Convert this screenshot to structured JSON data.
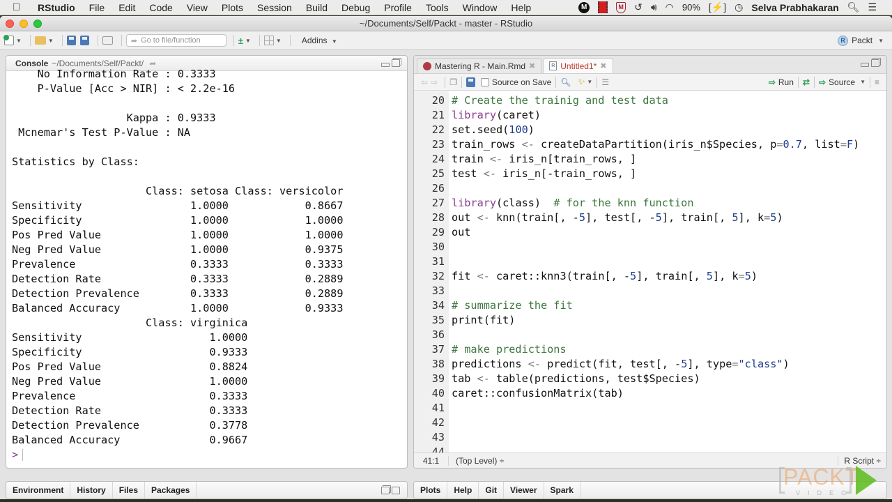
{
  "menubar": {
    "app_name": "RStudio",
    "items": [
      "File",
      "Edit",
      "Code",
      "View",
      "Plots",
      "Session",
      "Build",
      "Debug",
      "Profile",
      "Tools",
      "Window",
      "Help"
    ],
    "battery": "90%",
    "user": "Selva Prabhakaran"
  },
  "window": {
    "title": "~/Documents/Self/Packt - master - RStudio"
  },
  "toolbar": {
    "goto_placeholder": "Go to file/function",
    "addins_label": "Addins",
    "project_label": "Packt"
  },
  "console": {
    "title": "Console",
    "path": "~/Documents/Self/Packt/",
    "lines": [
      "    No Information Rate : 0.3333",
      "    P-Value [Acc > NIR] : < 2.2e-16",
      "",
      "                  Kappa : 0.9333",
      " Mcnemar's Test P-Value : NA",
      "",
      "Statistics by Class:",
      "",
      "                     Class: setosa Class: versicolor",
      "Sensitivity                 1.0000            0.8667",
      "Specificity                 1.0000            1.0000",
      "Pos Pred Value              1.0000            1.0000",
      "Neg Pred Value              1.0000            0.9375",
      "Prevalence                  0.3333            0.3333",
      "Detection Rate              0.3333            0.2889",
      "Detection Prevalence        0.3333            0.2889",
      "Balanced Accuracy           1.0000            0.9333",
      "                     Class: virginica",
      "Sensitivity                    1.0000",
      "Specificity                    0.9333",
      "Pos Pred Value                 0.8824",
      "Neg Pred Value                 1.0000",
      "Prevalence                     0.3333",
      "Detection Rate                 0.3333",
      "Detection Prevalence           0.3778",
      "Balanced Accuracy              0.9667"
    ],
    "prompt": ">"
  },
  "source": {
    "tabs": [
      {
        "label": "Mastering R - Main.Rmd",
        "active": false
      },
      {
        "label": "Untitled1*",
        "active": true
      }
    ],
    "source_on_save_label": "Source on Save",
    "run_label": "Run",
    "source_label": "Source",
    "first_line_number": 20,
    "code_lines": [
      [
        [
          "c",
          "# Create the trainig and test data"
        ]
      ],
      [
        [
          "k",
          "library"
        ],
        [
          "p",
          "(caret)"
        ]
      ],
      [
        [
          "p",
          "set.seed("
        ],
        [
          "n",
          "100"
        ],
        [
          "p",
          ")"
        ]
      ],
      [
        [
          "p",
          "train_rows "
        ],
        [
          "o",
          "<-"
        ],
        [
          "p",
          " createDataPartition(iris_n$Species, p"
        ],
        [
          "o",
          "="
        ],
        [
          "n",
          "0.7"
        ],
        [
          "p",
          ", list"
        ],
        [
          "o",
          "="
        ],
        [
          "n",
          "F"
        ],
        [
          "p",
          ")"
        ]
      ],
      [
        [
          "p",
          "train "
        ],
        [
          "o",
          "<-"
        ],
        [
          "p",
          " iris_n[train_rows, ]"
        ]
      ],
      [
        [
          "p",
          "test "
        ],
        [
          "o",
          "<-"
        ],
        [
          "p",
          " iris_n[-train_rows, ]"
        ]
      ],
      [],
      [
        [
          "k",
          "library"
        ],
        [
          "p",
          "(class)  "
        ],
        [
          "c",
          "# for the knn function"
        ]
      ],
      [
        [
          "p",
          "out "
        ],
        [
          "o",
          "<-"
        ],
        [
          "p",
          " knn(train[, -"
        ],
        [
          "n",
          "5"
        ],
        [
          "p",
          "], test[, -"
        ],
        [
          "n",
          "5"
        ],
        [
          "p",
          "], train[, "
        ],
        [
          "n",
          "5"
        ],
        [
          "p",
          "], k"
        ],
        [
          "o",
          "="
        ],
        [
          "n",
          "5"
        ],
        [
          "p",
          ")"
        ]
      ],
      [
        [
          "p",
          "out"
        ]
      ],
      [],
      [],
      [
        [
          "p",
          "fit "
        ],
        [
          "o",
          "<-"
        ],
        [
          "p",
          " caret::knn3(train[, -"
        ],
        [
          "n",
          "5"
        ],
        [
          "p",
          "], train[, "
        ],
        [
          "n",
          "5"
        ],
        [
          "p",
          "], k"
        ],
        [
          "o",
          "="
        ],
        [
          "n",
          "5"
        ],
        [
          "p",
          ")"
        ]
      ],
      [],
      [
        [
          "c",
          "# summarize the fit"
        ]
      ],
      [
        [
          "p",
          "print(fit)"
        ]
      ],
      [],
      [
        [
          "c",
          "# make predictions"
        ]
      ],
      [
        [
          "p",
          "predictions "
        ],
        [
          "o",
          "<-"
        ],
        [
          "p",
          " predict(fit, test[, -"
        ],
        [
          "n",
          "5"
        ],
        [
          "p",
          "], type"
        ],
        [
          "o",
          "="
        ],
        [
          "s",
          "\"class\""
        ],
        [
          "p",
          ")"
        ]
      ],
      [
        [
          "p",
          "tab "
        ],
        [
          "o",
          "<-"
        ],
        [
          "p",
          " table(predictions, test$Species)"
        ]
      ],
      [
        [
          "p",
          "caret::confusionMatrix(tab)"
        ]
      ],
      [],
      [],
      [],
      []
    ],
    "status": {
      "position": "41:1",
      "scope": "(Top Level) ÷",
      "file_type": "R Script ÷"
    }
  },
  "bottom_left_tabs": [
    "Environment",
    "History",
    "Files",
    "Packages"
  ],
  "bottom_right_tabs": [
    "Plots",
    "Help",
    "Git",
    "Viewer",
    "Spark"
  ],
  "watermark": {
    "text": "PACKT",
    "sub": "VIDEO"
  },
  "colors": {
    "comment": "#3c763d",
    "keyword": "#8a3e8a",
    "number": "#1f3d8c",
    "active_tab": "#c0392b"
  }
}
